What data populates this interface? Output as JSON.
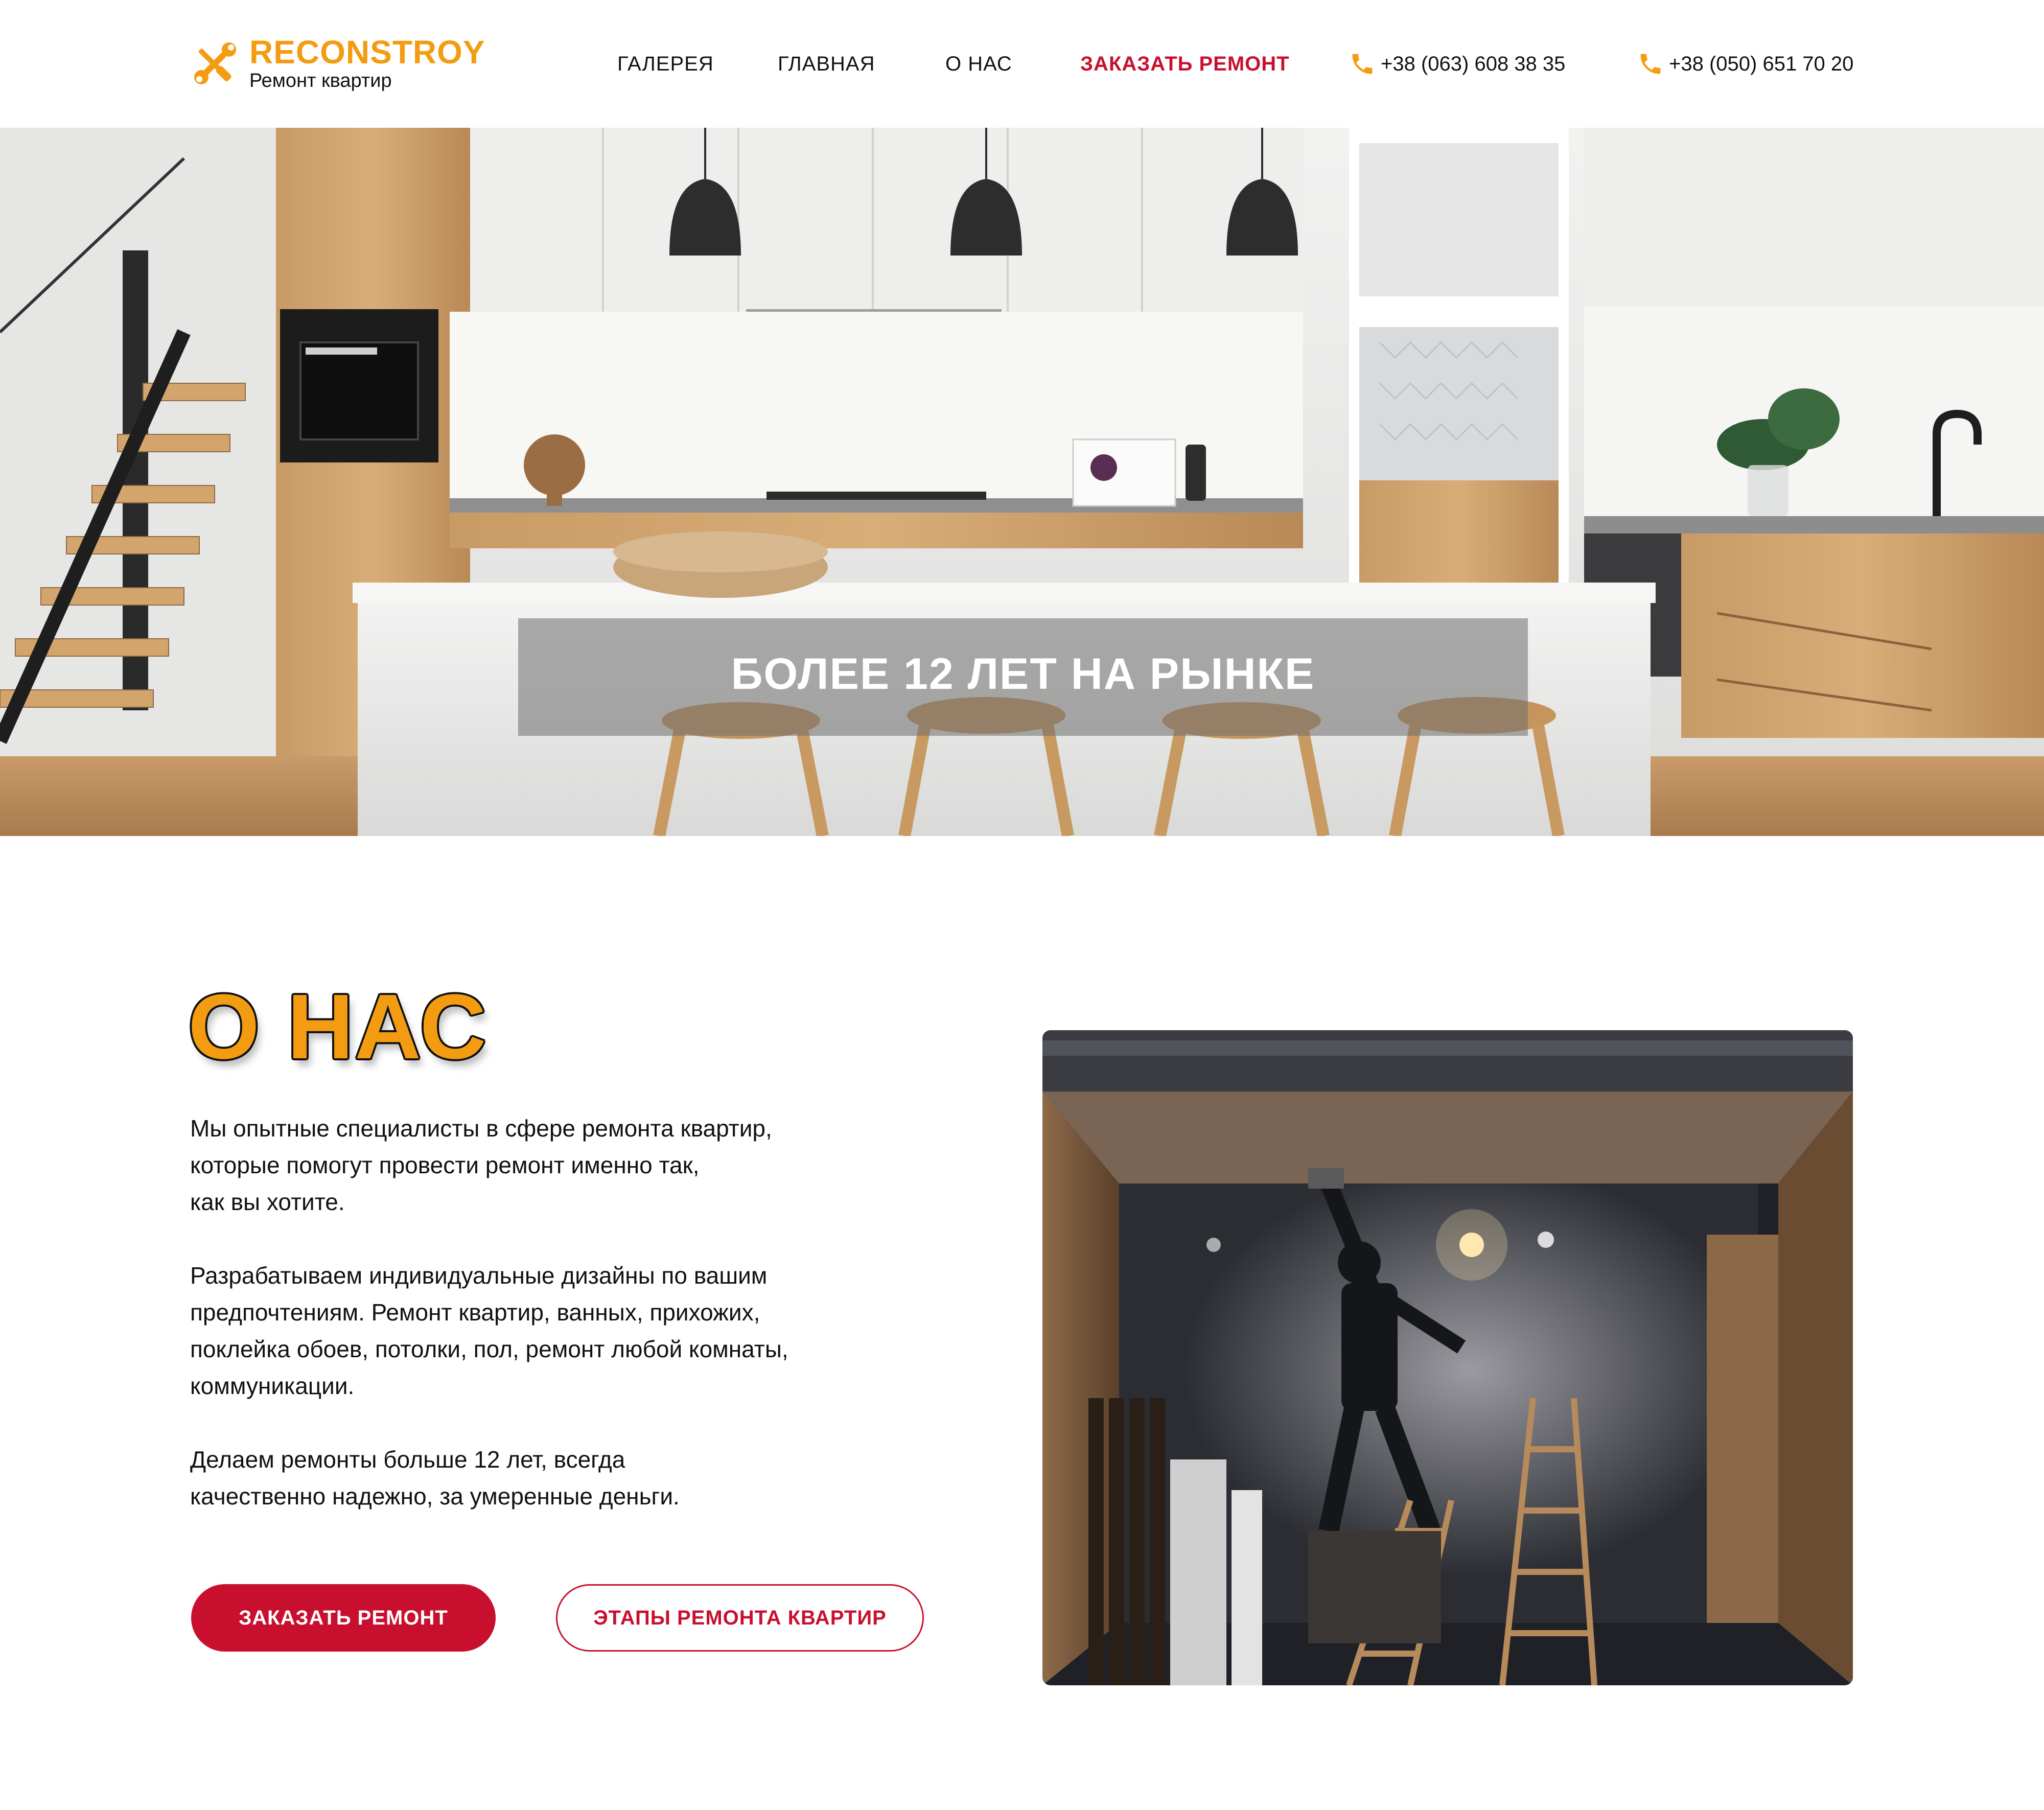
{
  "header": {
    "logo": {
      "name": "RECONSTROY",
      "subtitle": "Ремонт квартир"
    },
    "nav": [
      {
        "label": "ГАЛЕРЕЯ"
      },
      {
        "label": "ГЛАВНАЯ"
      },
      {
        "label": "О НАС"
      },
      {
        "label": "ЗАКАЗАТЬ РЕМОНТ",
        "active": true
      }
    ],
    "phones": [
      "+38 (063) 608 38 35",
      "+38 (050) 651 70 20"
    ]
  },
  "hero": {
    "title": "БОЛЕЕ 12 ЛЕТ НА РЫНКЕ"
  },
  "about": {
    "title": "О НАС",
    "paragraphs": [
      "Мы опытные специалисты в сфере ремонта квартир,\nкоторые помогут провести ремонт именно так,\nкак вы хотите.",
      "Разрабатываем индивидуальные дизайны по вашим\nпредпочтениям. Ремонт квартир, ванных, прихожих,\nпоклейка обоев, потолки, пол, ремонт любой комнаты,\nкоммуникации.",
      "Делаем ремонты больше 12 лет, всегда\nкачественно надежно, за умеренные деньги."
    ],
    "primary_button": "ЗАКАЗАТЬ РЕМОНТ",
    "secondary_button": "ЭТАПЫ РЕМОНТА КВАРТИР"
  },
  "colors": {
    "accent": "#f39c12",
    "brand_red": "#c8102e",
    "text": "#111111"
  },
  "icons": {
    "logo": "wrench-screwdriver-icon",
    "phone": "phone-icon"
  }
}
